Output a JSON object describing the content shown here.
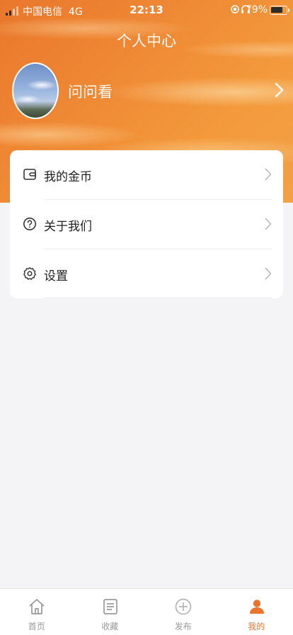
{
  "status_bar": {
    "carrier": "中国电信",
    "network": "4G",
    "time": "22:13",
    "battery_percent": "79%",
    "battery_level": 0.79
  },
  "header": {
    "title": "个人中心",
    "username": "问问看"
  },
  "menu": {
    "items": [
      {
        "label": "我的金币",
        "icon": "wallet-icon"
      },
      {
        "label": "关于我们",
        "icon": "question-circle-icon"
      },
      {
        "label": "设置",
        "icon": "gear-icon"
      }
    ]
  },
  "tabbar": {
    "items": [
      {
        "label": "首页",
        "icon": "home-icon"
      },
      {
        "label": "收藏",
        "icon": "list-icon"
      },
      {
        "label": "发布",
        "icon": "plus-circle-icon"
      },
      {
        "label": "我的",
        "icon": "user-icon"
      }
    ],
    "active_index": 3
  },
  "colors": {
    "accent": "#e8742d",
    "header_gradient_start": "#e9772c",
    "header_gradient_end": "#f2a046",
    "tab_inactive": "#999999",
    "background": "#f4f4f6"
  }
}
